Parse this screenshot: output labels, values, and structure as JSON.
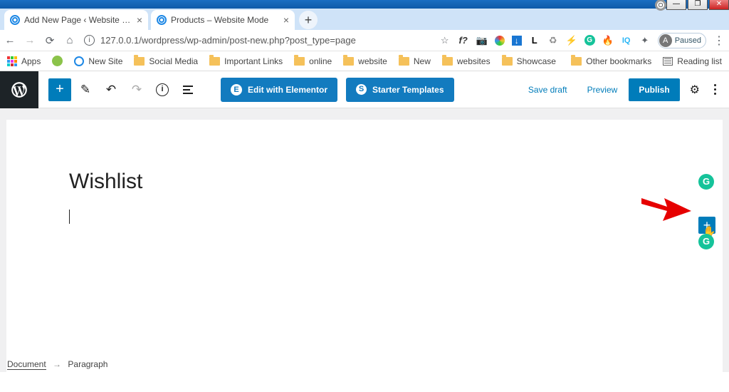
{
  "window": {
    "min": "—",
    "max": "❐",
    "close": "✕"
  },
  "tabs": [
    {
      "title": "Add New Page ‹ Website Mode"
    },
    {
      "title": "Products – Website Mode"
    }
  ],
  "url": "127.0.0.1/wordpress/wp-admin/post-new.php?post_type=page",
  "avatar": {
    "letter": "A",
    "label": "Paused"
  },
  "bookmarks": {
    "apps": "Apps",
    "items": [
      "New Site",
      "Social Media",
      "Important Links",
      "online",
      "website",
      "New",
      "websites",
      "Showcase"
    ],
    "other": "Other bookmarks",
    "reading": "Reading list"
  },
  "toolbar": {
    "elementor": "Edit with Elementor",
    "astra": "Starter Templates",
    "draft": "Save draft",
    "preview": "Preview",
    "publish": "Publish"
  },
  "page": {
    "title": "Wishlist"
  },
  "breadcrumb": {
    "root": "Document",
    "leaf": "Paragraph"
  },
  "icons": {
    "f": "f?",
    "L": "L",
    "dl": "↓",
    "G": "G",
    "iq": "IQ",
    "E": "E",
    "S": "S"
  }
}
